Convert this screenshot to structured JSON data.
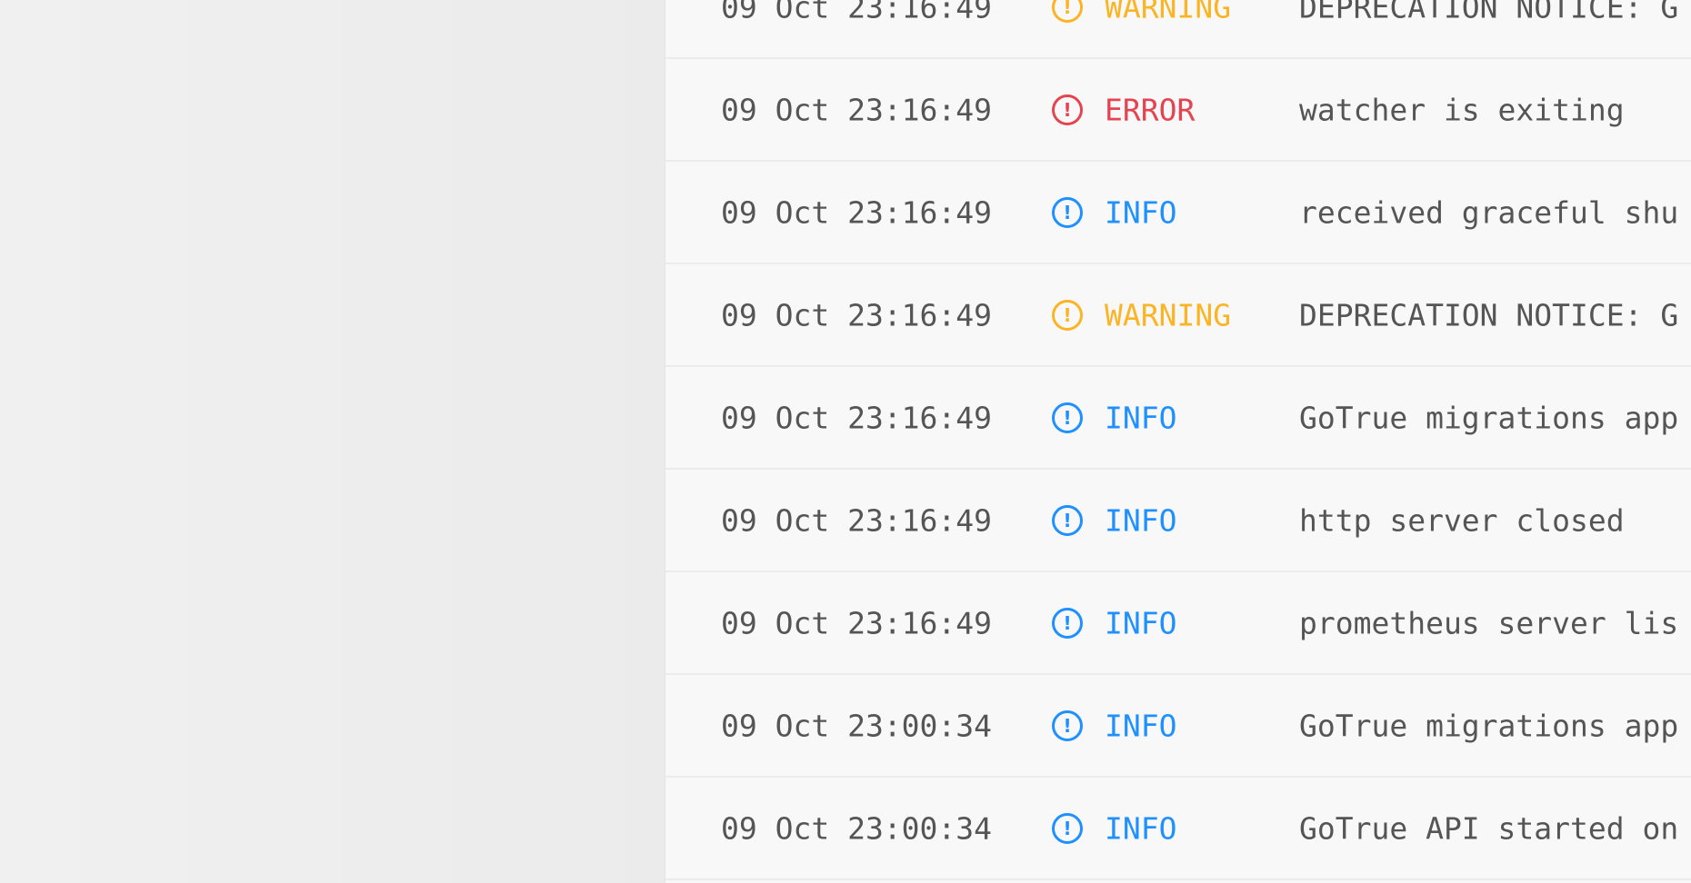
{
  "colors": {
    "WARNING": "#fbb424",
    "ERROR": "#e5434f",
    "INFO": "#1e90ff"
  },
  "logs": [
    {
      "timestamp": "09 Oct 23:16:49",
      "level": "WARNING",
      "icon": "exclamation-circle-icon",
      "message": "DEPRECATION NOTICE: G"
    },
    {
      "timestamp": "09 Oct 23:16:49",
      "level": "ERROR",
      "icon": "exclamation-circle-icon",
      "message": "watcher is exiting"
    },
    {
      "timestamp": "09 Oct 23:16:49",
      "level": "INFO",
      "icon": "exclamation-circle-icon",
      "message": "received graceful shu"
    },
    {
      "timestamp": "09 Oct 23:16:49",
      "level": "WARNING",
      "icon": "exclamation-circle-icon",
      "message": "DEPRECATION NOTICE: G"
    },
    {
      "timestamp": "09 Oct 23:16:49",
      "level": "INFO",
      "icon": "exclamation-circle-icon",
      "message": "GoTrue migrations app"
    },
    {
      "timestamp": "09 Oct 23:16:49",
      "level": "INFO",
      "icon": "exclamation-circle-icon",
      "message": "http server closed"
    },
    {
      "timestamp": "09 Oct 23:16:49",
      "level": "INFO",
      "icon": "exclamation-circle-icon",
      "message": "prometheus server lis"
    },
    {
      "timestamp": "09 Oct 23:00:34",
      "level": "INFO",
      "icon": "exclamation-circle-icon",
      "message": "GoTrue migrations app"
    },
    {
      "timestamp": "09 Oct 23:00:34",
      "level": "INFO",
      "icon": "exclamation-circle-icon",
      "message": "GoTrue API started on"
    }
  ]
}
